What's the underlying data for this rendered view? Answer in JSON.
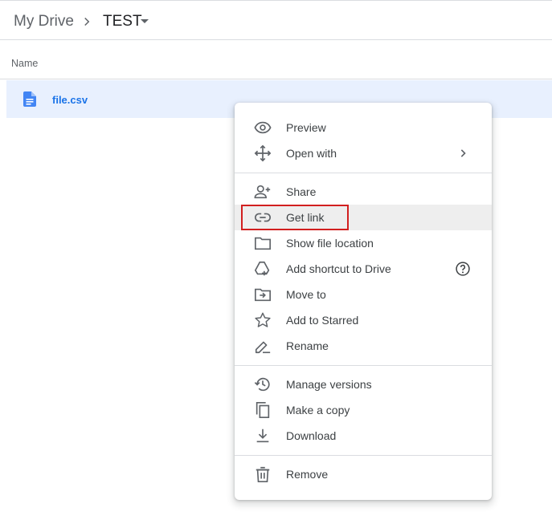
{
  "breadcrumb": {
    "root": "My Drive",
    "current": "TEST"
  },
  "list": {
    "column_name": "Name"
  },
  "file": {
    "name": "file.csv"
  },
  "menu": {
    "items": [
      {
        "label": "Preview",
        "icon": "eye-icon"
      },
      {
        "label": "Open with",
        "icon": "move-arrows-icon"
      },
      {
        "label": "Share",
        "icon": "person-add-icon"
      },
      {
        "label": "Get link",
        "icon": "link-icon"
      },
      {
        "label": "Show file location",
        "icon": "folder-icon"
      },
      {
        "label": "Add shortcut to Drive",
        "icon": "drive-shortcut-icon"
      },
      {
        "label": "Move to",
        "icon": "folder-move-icon"
      },
      {
        "label": "Add to Starred",
        "icon": "star-icon"
      },
      {
        "label": "Rename",
        "icon": "pencil-icon"
      },
      {
        "label": "Manage versions",
        "icon": "history-icon"
      },
      {
        "label": "Make a copy",
        "icon": "copy-icon"
      },
      {
        "label": "Download",
        "icon": "download-icon"
      },
      {
        "label": "Remove",
        "icon": "trash-icon"
      }
    ]
  },
  "colors": {
    "selection": "#e8f0fe",
    "file_accent": "#1a73e8",
    "hover": "#eeeeee",
    "highlight_box": "#d21f1f"
  }
}
